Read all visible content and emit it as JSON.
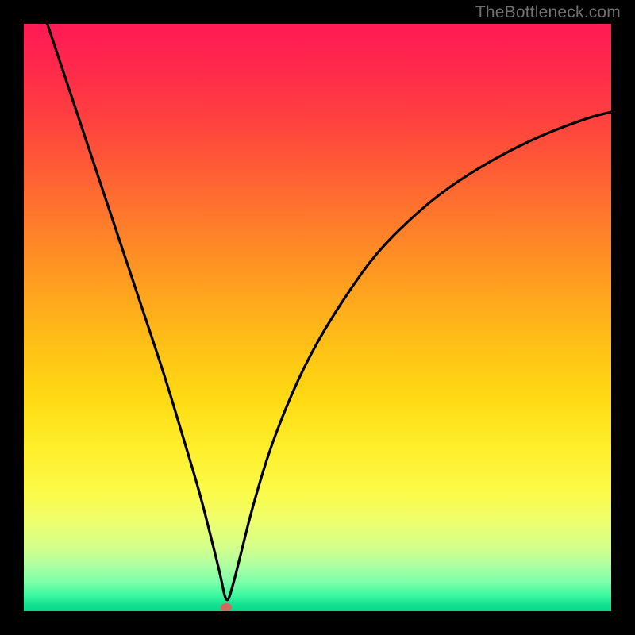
{
  "watermark": "TheBottleneck.com",
  "chart_data": {
    "type": "line",
    "title": "",
    "xlabel": "",
    "ylabel": "",
    "xlim": [
      0,
      100
    ],
    "ylim": [
      0,
      100
    ],
    "gradient_stops": [
      {
        "pct": 0,
        "color": "#ff1a55"
      },
      {
        "pct": 16,
        "color": "#ff4040"
      },
      {
        "pct": 32,
        "color": "#ff752d"
      },
      {
        "pct": 48,
        "color": "#ffab1c"
      },
      {
        "pct": 64,
        "color": "#ffdb14"
      },
      {
        "pct": 80,
        "color": "#fbfb4a"
      },
      {
        "pct": 92,
        "color": "#b0ffa0"
      },
      {
        "pct": 100,
        "color": "#08d888"
      }
    ],
    "series": [
      {
        "name": "bottleneck-curve",
        "x": [
          4,
          8,
          12,
          16,
          20,
          24,
          27,
          30,
          32,
          33.5,
          34.5,
          35.5,
          37,
          39,
          42,
          46,
          50,
          55,
          60,
          66,
          72,
          80,
          88,
          96,
          100
        ],
        "y": [
          100,
          88,
          76,
          64,
          52,
          40,
          30,
          20,
          12,
          6,
          1,
          4,
          10,
          18,
          28,
          38,
          46,
          54,
          61,
          67,
          72,
          77,
          81,
          84,
          85
        ]
      }
    ],
    "marker": {
      "x": 34.5,
      "y": 0.7,
      "color": "#d46a5d"
    }
  }
}
